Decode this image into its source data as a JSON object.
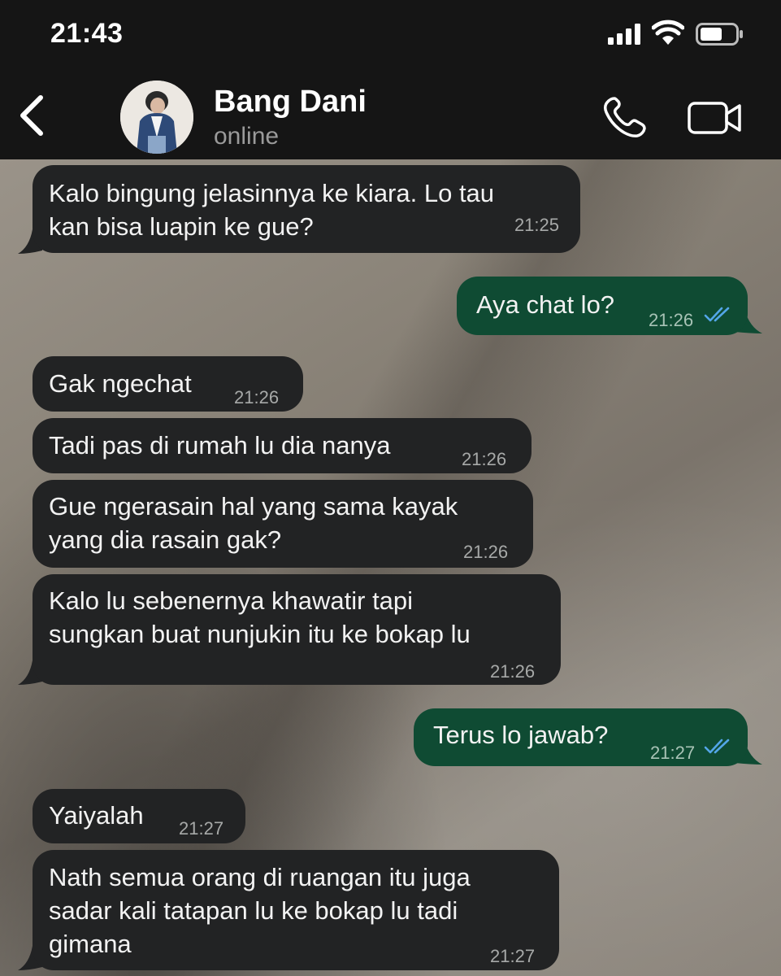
{
  "status_bar": {
    "time": "21:43",
    "signal_icon": "cellular-signal-icon",
    "wifi_icon": "wifi-icon",
    "battery_icon": "battery-icon"
  },
  "header": {
    "back_icon": "chevron-left-icon",
    "contact_name": "Bang Dani",
    "contact_status": "online",
    "call_icon": "phone-icon",
    "video_icon": "video-camera-icon"
  },
  "colors": {
    "incoming_bubble": "#222324",
    "outgoing_bubble": "#0f4b33",
    "read_ticks": "#53a6e8",
    "header_bg": "#151515"
  },
  "messages": [
    {
      "direction": "in",
      "text": "Kalo bingung jelasinnya ke kiara. Lo tau\nkan bisa luapin ke gue?",
      "time": "21:25"
    },
    {
      "direction": "out",
      "text": "Aya chat lo?",
      "time": "21:26",
      "status": "read"
    },
    {
      "direction": "in",
      "text": "Gak ngechat",
      "time": "21:26"
    },
    {
      "direction": "in",
      "text": "Tadi pas di rumah lu dia nanya",
      "time": "21:26"
    },
    {
      "direction": "in",
      "text": "Gue ngerasain hal yang sama kayak\nyang dia rasain gak?",
      "time": "21:26"
    },
    {
      "direction": "in",
      "text": "Kalo lu sebenernya khawatir tapi\nsungkan buat nunjukin itu ke bokap lu",
      "time": "21:26"
    },
    {
      "direction": "out",
      "text": "Terus lo jawab?",
      "time": "21:27",
      "status": "read"
    },
    {
      "direction": "in",
      "text": "Yaiyalah",
      "time": "21:27"
    },
    {
      "direction": "in",
      "text": "Nath semua orang di ruangan itu juga\nsadar kali tatapan lu ke bokap lu tadi\ngimana",
      "time": "21:27"
    }
  ]
}
